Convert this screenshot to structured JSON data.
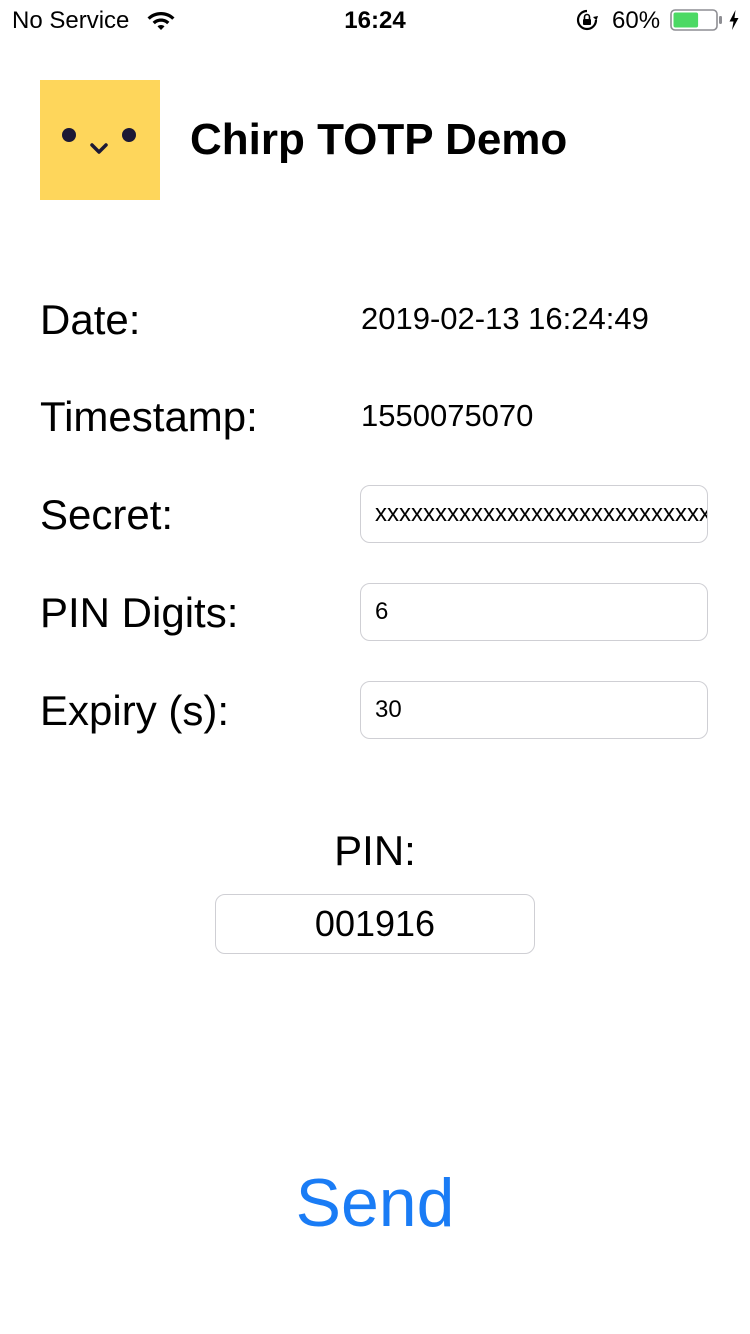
{
  "status_bar": {
    "carrier": "No Service",
    "time": "16:24",
    "battery_percent": "60%",
    "battery_level": 0.6,
    "battery_color": "#4cd964",
    "icons": [
      "wifi-icon",
      "lock-rotation-icon",
      "battery-icon",
      "bolt-icon"
    ]
  },
  "header": {
    "title": "Chirp TOTP Demo",
    "logo_color": "#fed65b",
    "logo_icon": "smiley-face-icon"
  },
  "form": {
    "date": {
      "label": "Date:",
      "value": "2019-02-13 16:24:49"
    },
    "timestamp": {
      "label": "Timestamp:",
      "value": "1550075070"
    },
    "secret": {
      "label": "Secret:",
      "value": "xxxxxxxxxxxxxxxxxxxxxxxxxxxxxxxx"
    },
    "pin_digits": {
      "label": "PIN Digits:",
      "value": "6"
    },
    "expiry": {
      "label": "Expiry (s):",
      "value": "30"
    }
  },
  "pin": {
    "label": "PIN:",
    "value": "001916"
  },
  "send_button": {
    "label": "Send",
    "color": "#1a7cf5"
  }
}
